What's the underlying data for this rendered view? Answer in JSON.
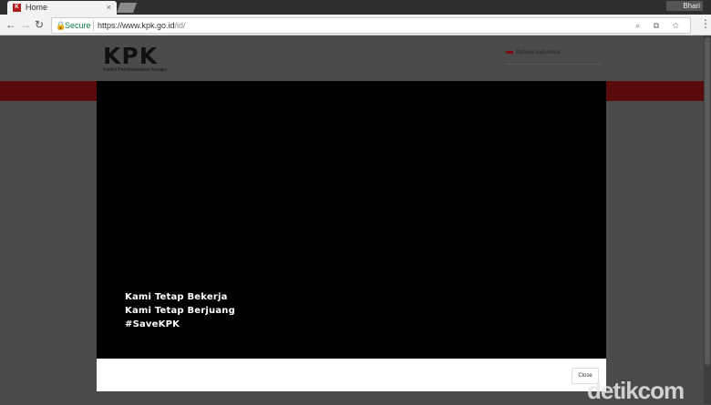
{
  "browser": {
    "tab_title": "Home",
    "tab_close": "×",
    "user_label": "Bhari",
    "secure_label": "Secure",
    "url_host": "https://www.kpk.go.id",
    "url_path": "/id/",
    "nav_back": "←",
    "nav_forward": "→",
    "nav_reload": "↻",
    "omni_icons": "⌕ ⧉ ☆",
    "menu": "⋮"
  },
  "site": {
    "logo_text": "KPK",
    "logo_sub": "Komisi Pemberantasan Korupsi",
    "language": "Bahasa Indonesia"
  },
  "modal": {
    "lines": [
      "Kami Tetap Bekerja",
      "Kami Tetap Berjuang",
      "#SaveKPK"
    ],
    "close_label": "Close"
  },
  "watermark": "detikcom",
  "colors": {
    "accent_red": "#5a0a0a",
    "overlay": "#4b4b4b"
  }
}
